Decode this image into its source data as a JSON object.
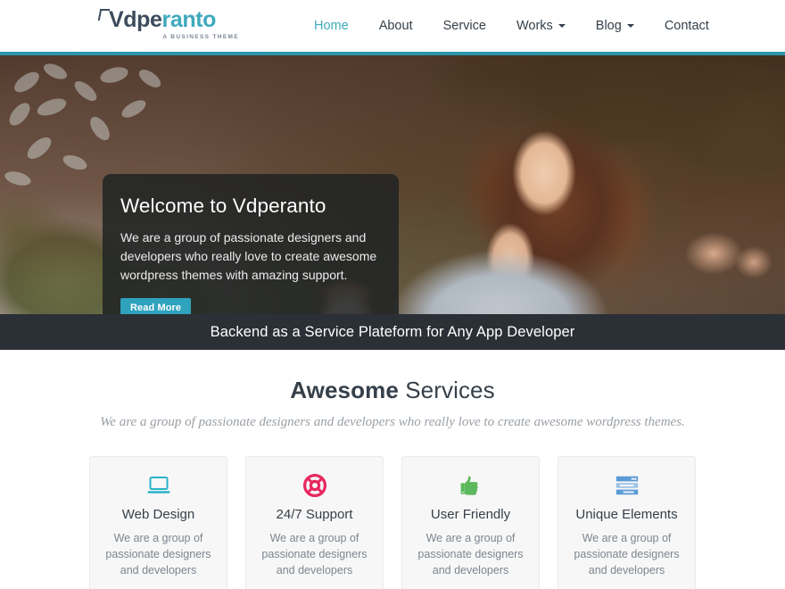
{
  "colors": {
    "accent_teal": "#3fa9bd",
    "logo_dark": "#3d4c5c",
    "button_teal": "#2fa2bd",
    "tagline_bar_bg": "#2b3036",
    "heading_dark": "#36404a",
    "card_bg": "#f7f7f7",
    "icon_web_design": "#2cb3c9",
    "icon_support": "#e8275e",
    "icon_friendly": "#5cb85c",
    "icon_elements": "#5a9bd5"
  },
  "header": {
    "logo": {
      "text_dark": "Vdpe",
      "text_accent": "ranto",
      "tagline": "A BUSINESS THEME",
      "bracket_icon": "corner-bracket-icon"
    },
    "nav": [
      {
        "label": "Home",
        "active": true,
        "has_dropdown": false
      },
      {
        "label": "About",
        "active": false,
        "has_dropdown": false
      },
      {
        "label": "Service",
        "active": false,
        "has_dropdown": false
      },
      {
        "label": "Works",
        "active": false,
        "has_dropdown": true
      },
      {
        "label": "Blog",
        "active": false,
        "has_dropdown": true
      },
      {
        "label": "Contact",
        "active": false,
        "has_dropdown": false
      }
    ]
  },
  "hero": {
    "title": "Welcome to Vdperanto",
    "body": "We are a group of passionate designers and developers who really love to create awesome wordpress themes with amazing support.",
    "button_label": "Read More",
    "image_description": "Young woman with long auburn hair holding a colorful smartphone at a cafe, green hedge and plants in background, coffee cup on table"
  },
  "tagline_bar": {
    "text": "Backend as a Service Plateform for Any App Developer"
  },
  "services": {
    "heading_bold": "Awesome",
    "heading_rest": " Services",
    "subtitle": "We are a group of passionate designers and developers who really love to create awesome wordpress themes.",
    "cards": [
      {
        "icon": "laptop-icon",
        "title": "Web Design",
        "text": "We are a group of passionate designers and developers"
      },
      {
        "icon": "lifebuoy-icon",
        "title": "24/7 Support",
        "text": "We are a group of passionate designers and developers"
      },
      {
        "icon": "thumbs-up-icon",
        "title": "User Friendly",
        "text": "We are a group of passionate designers and developers"
      },
      {
        "icon": "server-list-icon",
        "title": "Unique Elements",
        "text": "We are a group of passionate designers and developers"
      }
    ]
  }
}
